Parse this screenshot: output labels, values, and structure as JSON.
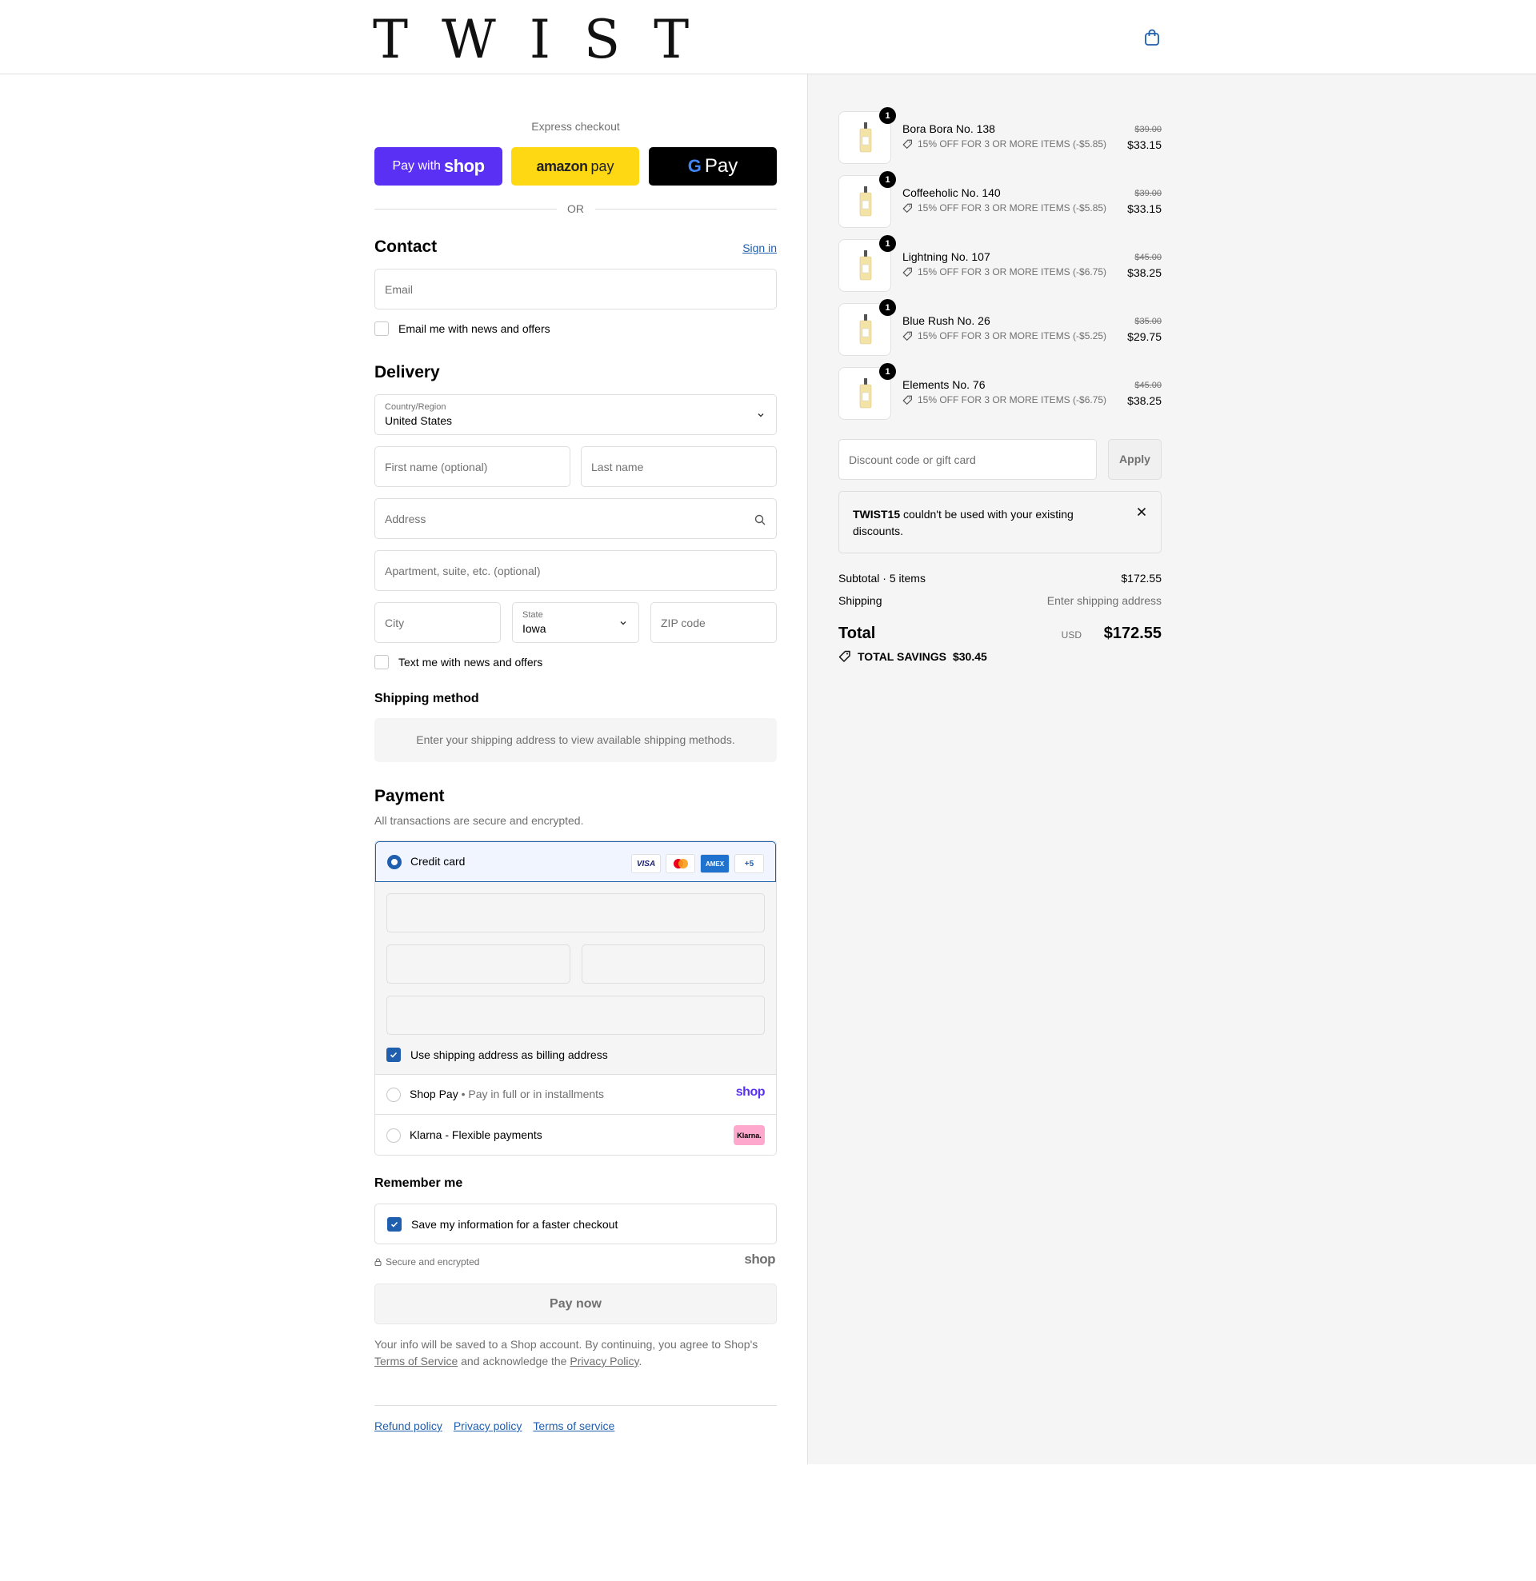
{
  "header": {
    "logo": "TWIST"
  },
  "express": {
    "title": "Express checkout",
    "shop_pay_prefix": "Pay with",
    "shop_pay_brand": "shop",
    "amazon_brand": "amazon",
    "amazon_suffix": "pay",
    "gpay_g": "G",
    "gpay_label": "Pay",
    "or": "OR"
  },
  "contact": {
    "heading": "Contact",
    "sign_in": "Sign in",
    "email_placeholder": "Email",
    "newsletter_label": "Email me with news and offers"
  },
  "delivery": {
    "heading": "Delivery",
    "country_label": "Country/Region",
    "country_value": "United States",
    "first_name_placeholder": "First name (optional)",
    "last_name_placeholder": "Last name",
    "address_placeholder": "Address",
    "apartment_placeholder": "Apartment, suite, etc. (optional)",
    "city_placeholder": "City",
    "state_label": "State",
    "state_value": "Iowa",
    "zip_placeholder": "ZIP code",
    "sms_label": "Text me with news and offers"
  },
  "shipping_method": {
    "heading": "Shipping method",
    "info": "Enter your shipping address to view available shipping methods."
  },
  "payment": {
    "heading": "Payment",
    "subtitle": "All transactions are secure and encrypted.",
    "credit_card_label": "Credit card",
    "card_logos": [
      "VISA",
      "MC",
      "AMEX",
      "+5"
    ],
    "billing_label": "Use shipping address as billing address",
    "shop_pay_label": "Shop Pay",
    "shop_pay_sub": "Pay in full or in installments",
    "shop_brand": "shop",
    "klarna_label": "Klarna - Flexible payments",
    "klarna_brand": "Klarna."
  },
  "remember": {
    "heading": "Remember me",
    "save_label": "Save my information for a faster checkout",
    "secure": "Secure and encrypted",
    "shop_brand": "shop"
  },
  "pay_now": "Pay now",
  "legal": {
    "text1": "Your info will be saved to a Shop account. By continuing, you agree to Shop's",
    "terms": "Terms of Service",
    "text2": "and acknowledge the",
    "privacy": "Privacy Policy",
    "text3": "."
  },
  "footer": {
    "refund": "Refund policy",
    "privacy": "Privacy policy",
    "terms": "Terms of service"
  },
  "cart": {
    "items": [
      {
        "name": "Bora Bora No. 138",
        "qty": "1",
        "discount": "15% OFF FOR 3 OR MORE ITEMS (-$5.85)",
        "old_price": "$39.00",
        "price": "$33.15"
      },
      {
        "name": "Coffeeholic No. 140",
        "qty": "1",
        "discount": "15% OFF FOR 3 OR MORE ITEMS (-$5.85)",
        "old_price": "$39.00",
        "price": "$33.15"
      },
      {
        "name": "Lightning No. 107",
        "qty": "1",
        "discount": "15% OFF FOR 3 OR MORE ITEMS (-$6.75)",
        "old_price": "$45.00",
        "price": "$38.25"
      },
      {
        "name": "Blue Rush No. 26",
        "qty": "1",
        "discount": "15% OFF FOR 3 OR MORE ITEMS (-$5.25)",
        "old_price": "$35.00",
        "price": "$29.75"
      },
      {
        "name": "Elements No. 76",
        "qty": "1",
        "discount": "15% OFF FOR 3 OR MORE ITEMS (-$6.75)",
        "old_price": "$45.00",
        "price": "$38.25"
      }
    ],
    "discount_placeholder": "Discount code or gift card",
    "apply": "Apply",
    "error_code": "TWIST15",
    "error_msg": " couldn't be used with your existing discounts.",
    "subtotal_label": "Subtotal · 5 items",
    "subtotal_value": "$172.55",
    "shipping_label": "Shipping",
    "shipping_value": "Enter shipping address",
    "total_label": "Total",
    "currency": "USD",
    "total_value": "$172.55",
    "savings_label": "TOTAL SAVINGS",
    "savings_value": "$30.45"
  },
  "colors": {
    "accent": "#1f5fae",
    "shop_purple": "#5a31f4",
    "amazon_yellow": "#ffd814",
    "klarna_pink": "#ffa8cd"
  }
}
